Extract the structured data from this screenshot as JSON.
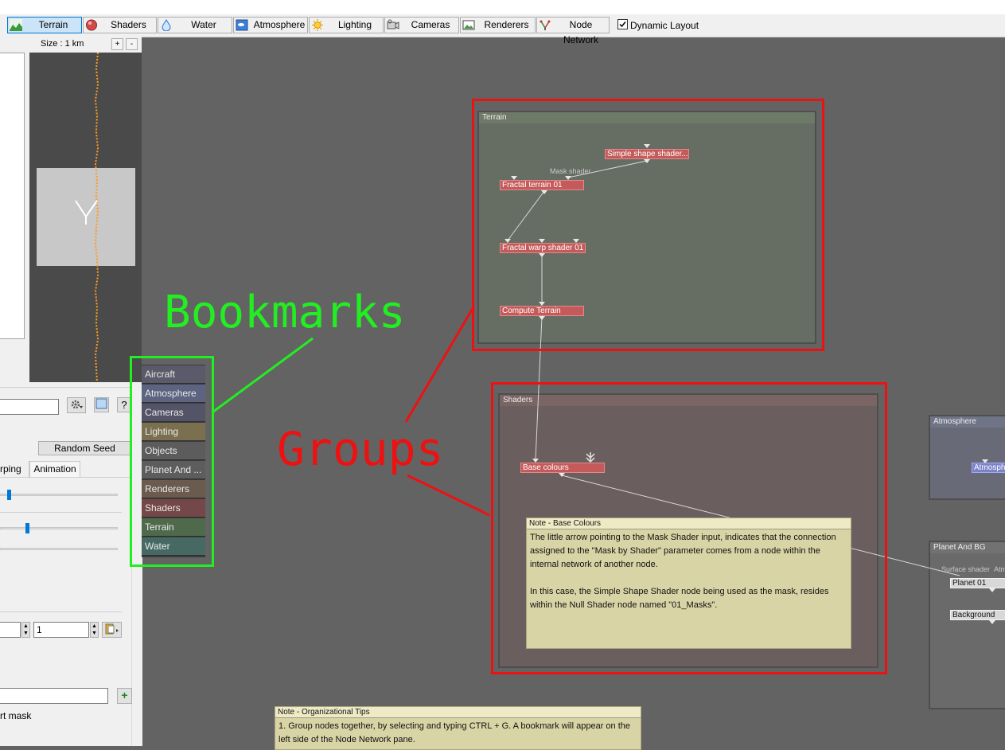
{
  "toolbar": {
    "tabs": [
      {
        "label": "Terrain",
        "icon": "terrain-icon",
        "active": true
      },
      {
        "label": "Shaders",
        "icon": "shader-sphere-icon"
      },
      {
        "label": "Water",
        "icon": "water-drop-icon"
      },
      {
        "label": "Atmosphere",
        "icon": "atmosphere-icon"
      },
      {
        "label": "Lighting",
        "icon": "sun-icon"
      },
      {
        "label": "Cameras",
        "icon": "camera-icon"
      },
      {
        "label": "Renderers",
        "icon": "renderer-icon"
      },
      {
        "label": "Node Network",
        "icon": "node-network-icon"
      }
    ],
    "dynamic_layout": {
      "label": "Dynamic Layout",
      "checked": true
    }
  },
  "preview": {
    "size_label": "Size : 1 km",
    "zoom_in": "+",
    "zoom_out": "-"
  },
  "left_panel": {
    "random_seed": "Random Seed",
    "help": "?",
    "tab_warping": "rping",
    "tab_animation": "Animation",
    "spinner_value": "1",
    "mask_label": "rt mask",
    "add": "+"
  },
  "bookmarks": [
    {
      "label": "Aircraft",
      "color": "#5a5a6a"
    },
    {
      "label": "Atmosphere",
      "color": "#5c6481"
    },
    {
      "label": "Cameras",
      "color": "#545469"
    },
    {
      "label": "Lighting",
      "color": "#7a7050"
    },
    {
      "label": "Objects",
      "color": "#5c5c5c"
    },
    {
      "label": "Planet And ...",
      "color": "#5d5d5d"
    },
    {
      "label": "Renderers",
      "color": "#6b5a4e"
    },
    {
      "label": "Shaders",
      "color": "#744848"
    },
    {
      "label": "Terrain",
      "color": "#4e6a4a"
    },
    {
      "label": "Water",
      "color": "#466a63"
    }
  ],
  "groups": {
    "terrain": {
      "title": "Terrain",
      "nodes": {
        "simple_shape": "Simple shape shader...",
        "fractal_terrain": "Fractal terrain 01",
        "fractal_warp": "Fractal warp shader 01",
        "compute_terrain": "Compute Terrain"
      },
      "mask_label": "Mask shader"
    },
    "shaders": {
      "title": "Shaders",
      "nodes": {
        "base_colours": "Base colours"
      },
      "note": {
        "title": "Note - Base Colours",
        "p1": "The little arrow pointing to the Mask Shader input, indicates that the connection assigned to the \"Mask by Shader\" parameter comes from a node within the internal network of another node.",
        "p2": "In this case, the Simple Shape Shader node being used as the mask, resides within the Null Shader node named \"01_Masks\"."
      }
    },
    "atmosphere": {
      "title": "Atmosphere",
      "node": "Atmosph"
    },
    "planet": {
      "title": "Planet And BG",
      "labels": {
        "surface": "Surface shader",
        "atm": "Atm"
      },
      "nodes": {
        "planet": "Planet 01",
        "background": "Background"
      }
    }
  },
  "org_note": {
    "title": "Note - Organizational Tips",
    "body": "1. Group nodes together, by selecting and typing CTRL + G.  A bookmark will appear on the left side of the Node Network pane."
  },
  "annotations": {
    "bookmarks": "Bookmarks",
    "groups": "Groups",
    "bookmarks_color": "#22ee22",
    "groups_color": "#ee1111"
  }
}
